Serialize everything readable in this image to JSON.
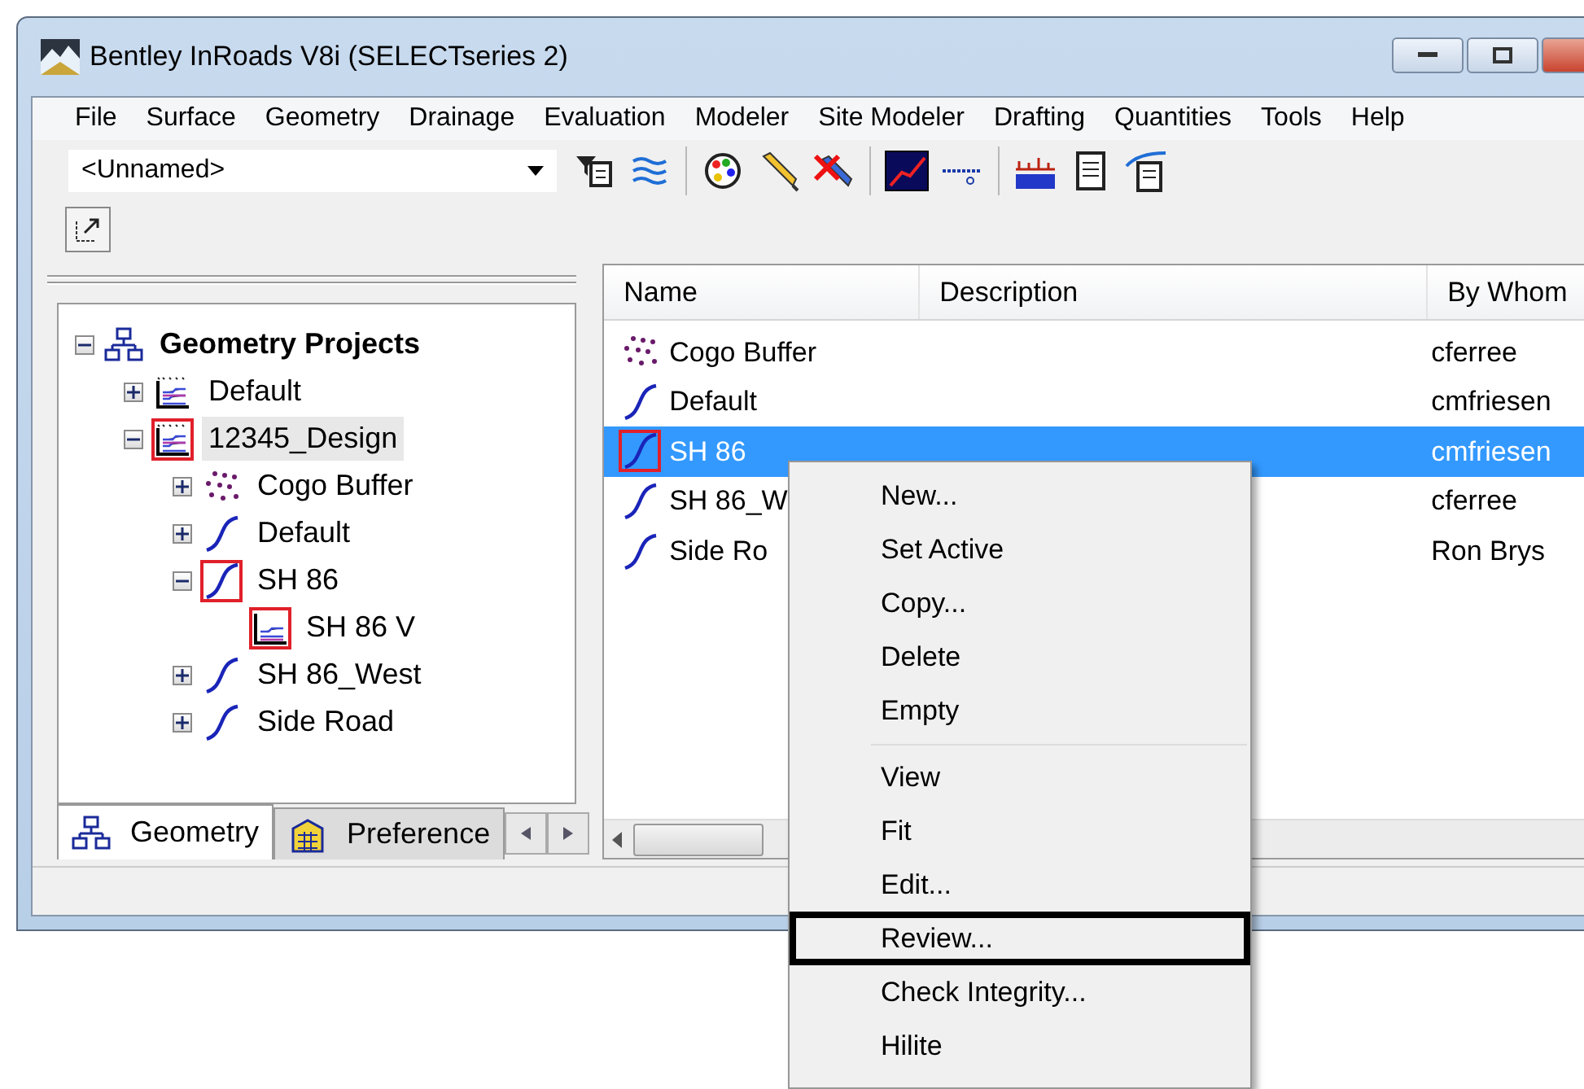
{
  "window": {
    "title": "Bentley InRoads V8i (SELECTseries 2)"
  },
  "menu": [
    "File",
    "Surface",
    "Geometry",
    "Drainage",
    "Evaluation",
    "Modeler",
    "Site Modeler",
    "Drafting",
    "Quantities",
    "Tools",
    "Help"
  ],
  "toolbar": {
    "combo_value": "<Unnamed>"
  },
  "tree": [
    {
      "label": "Geometry Projects",
      "kind": "root",
      "expanded": true,
      "active": false,
      "selected": false,
      "children": [
        {
          "label": "Default",
          "kind": "project",
          "expanded": false,
          "active": false,
          "selected": false
        },
        {
          "label": "12345_Design",
          "kind": "project",
          "expanded": true,
          "active": true,
          "selected": true,
          "children": [
            {
              "label": "Cogo Buffer",
              "kind": "cogo",
              "expanded": false,
              "active": false,
              "selected": false
            },
            {
              "label": "Default",
              "kind": "alignment",
              "expanded": false,
              "active": false,
              "selected": false
            },
            {
              "label": "SH 86",
              "kind": "alignment",
              "expanded": true,
              "active": true,
              "selected": false,
              "children": [
                {
                  "label": "SH 86 V",
                  "kind": "profile",
                  "active": true,
                  "selected": false
                }
              ]
            },
            {
              "label": "SH 86_West",
              "kind": "alignment",
              "expanded": false,
              "active": false,
              "selected": false
            },
            {
              "label": "Side Road",
              "kind": "alignment",
              "expanded": false,
              "active": false,
              "selected": false
            }
          ]
        }
      ]
    }
  ],
  "tabs": [
    {
      "label": "Geometry",
      "kind": "geometry",
      "selected": true
    },
    {
      "label": "Preference",
      "kind": "preference",
      "selected": false
    }
  ],
  "list": {
    "columns": [
      "Name",
      "Description",
      "By Whom"
    ],
    "rows": [
      {
        "name": "Cogo Buffer",
        "by_whom": "cferree",
        "kind": "cogo",
        "selected": false,
        "active": false
      },
      {
        "name": "Default",
        "by_whom": "cmfriesen",
        "kind": "alignment",
        "selected": false,
        "active": false
      },
      {
        "name": "SH 86",
        "by_whom": "cmfriesen",
        "kind": "alignment",
        "selected": true,
        "active": true
      },
      {
        "name": "SH 86_W",
        "by_whom": "cferree",
        "kind": "alignment",
        "selected": false,
        "active": false
      },
      {
        "name": "Side Ro",
        "by_whom": "Ron Brys",
        "kind": "alignment",
        "selected": false,
        "active": false
      }
    ]
  },
  "context_menu": [
    {
      "kind": "item",
      "label": "New...",
      "highlighted": false
    },
    {
      "kind": "item",
      "label": "Set Active",
      "highlighted": false
    },
    {
      "kind": "item",
      "label": "Copy...",
      "highlighted": false
    },
    {
      "kind": "item",
      "label": "Delete",
      "highlighted": false
    },
    {
      "kind": "item",
      "label": "Empty",
      "highlighted": false
    },
    {
      "kind": "separator"
    },
    {
      "kind": "item",
      "label": "View",
      "highlighted": false
    },
    {
      "kind": "item",
      "label": "Fit",
      "highlighted": false
    },
    {
      "kind": "item",
      "label": "Edit...",
      "highlighted": false
    },
    {
      "kind": "item",
      "label": "Review...",
      "highlighted": true
    },
    {
      "kind": "item",
      "label": "Check Integrity...",
      "highlighted": false
    },
    {
      "kind": "item",
      "label": "Hilite",
      "highlighted": false
    }
  ]
}
